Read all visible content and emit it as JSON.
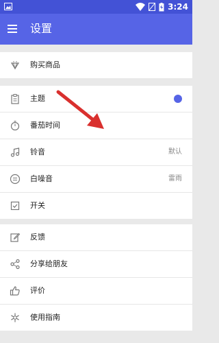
{
  "status": {
    "time": "3:24"
  },
  "header": {
    "title": "设置"
  },
  "sections": {
    "store": [
      "购买商品"
    ],
    "prefs": [
      "主题",
      "番茄时间",
      "铃音",
      "白噪音",
      "开关"
    ],
    "more": [
      "反馈",
      "分享给朋友",
      "评价",
      "使用指南"
    ]
  },
  "values": {
    "ringtone": "默认",
    "whitenoise": "雷雨"
  },
  "colors": {
    "accent": "#5664e6",
    "statusbar": "#4352d6",
    "annotation_arrow": "#d9302e"
  }
}
